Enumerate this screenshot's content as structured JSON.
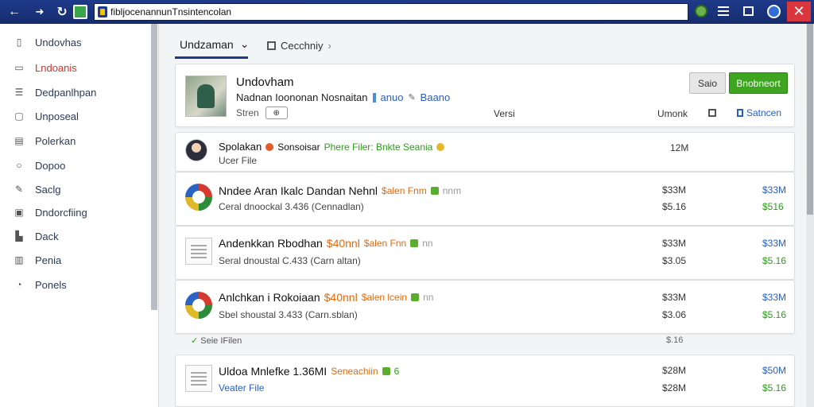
{
  "browser": {
    "address": "fibljocenannunTnsintencolan",
    "close_glyph": "✕"
  },
  "sidebar": {
    "items": [
      {
        "label": "Undovhas",
        "icon": "▯"
      },
      {
        "label": "Lndoanis",
        "icon": "▭",
        "active": true
      },
      {
        "label": "Dedpanlhpan",
        "icon": "☰"
      },
      {
        "label": "Unposeal",
        "icon": "▢"
      },
      {
        "label": "Polerkan",
        "icon": "▤"
      },
      {
        "label": "Dopoo",
        "icon": "○"
      },
      {
        "label": "Saclg",
        "icon": "✎"
      },
      {
        "label": "Dndorcfiing",
        "icon": "▣"
      },
      {
        "label": "Dack",
        "icon": "▙"
      },
      {
        "label": "Penia",
        "icon": "▥"
      },
      {
        "label": "Ponels",
        "icon": "◔"
      }
    ]
  },
  "tabs": [
    {
      "label": "Undzaman",
      "caret": "⌄"
    },
    {
      "label": "Cecchniy",
      "caret": "›"
    }
  ],
  "header": {
    "title": "Undovham",
    "subtitle": "Nadnan Ioononan Nosnaitan",
    "link1": "anuo",
    "link2": "Baano",
    "status": "Stren",
    "chip": "⊕",
    "col1": "Versi",
    "col2": "Umonk",
    "link3": "Satncen",
    "btn_gray": "Saio",
    "btn_green": "Bnobneort"
  },
  "rows": [
    {
      "title": "Spolakan",
      "tag1": "Sonsoisar",
      "tag2": "Phere Filer: Bnkte Seania",
      "sub": "Ucer File",
      "v1": "12M",
      "v2": "",
      "thumb": "face"
    },
    {
      "title": "Nndee Aran Ikalc Dandan Nehnl",
      "tag1": "$alen Fnm",
      "tag2": "nnm",
      "sub": "Ceral dnoockal 3.436 (Cennadlan)",
      "v1": "$33M",
      "v2": "$33M",
      "v3": "$5.16",
      "v4": "$516",
      "thumb": "circle"
    },
    {
      "title": "Andenkkan Rbodhan",
      "tag1": "$40nnl",
      "tag2": "$alen Fnn",
      "tag3": "nn",
      "sub": "Seral dnoustal C.433 (Carn altan)",
      "v1": "$33M",
      "v2": "$33M",
      "v3": "$3.05",
      "v4": "$5.16",
      "thumb": "doc"
    },
    {
      "title": "Anlchkan i Rokoiaan",
      "tag1": "$40nnl",
      "tag2": "$alen lcein",
      "tag3": "nn",
      "sub": "Sbel shoustal 3.433 (Carn.sblan)",
      "v1": "$33M",
      "v2": "$33M",
      "v3": "$3.06",
      "v4": "$5.16",
      "thumb": "circle"
    },
    {
      "title": "Uldoa Mnlefke 1.36MI",
      "tag1": "Seneachiin",
      "tag2": "6",
      "sub": "Veater File",
      "v1": "$28M",
      "v2": "$50M",
      "v3": "$28M",
      "v4": "$5.16",
      "thumb": "doc"
    }
  ],
  "floating": {
    "text": "Seie IFilen",
    "value": "$.16"
  },
  "colors": {
    "titlebar": "#1e3a8a",
    "accent_green": "#3da520",
    "link_blue": "#2a5fbf",
    "warn_orange": "#e06a10"
  }
}
